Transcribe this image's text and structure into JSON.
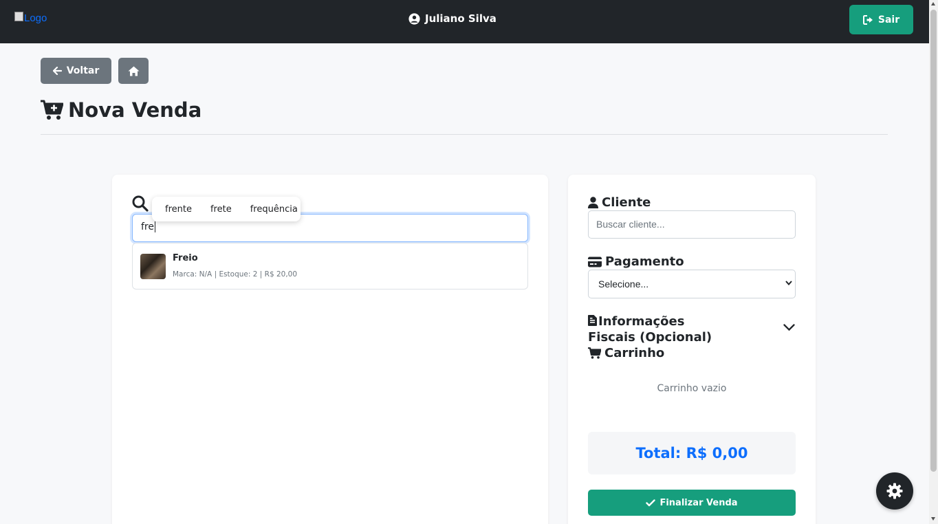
{
  "navbar": {
    "logo_alt": "Logo",
    "user_name": "Juliano Silva",
    "logout_label": "Sair"
  },
  "toolbar": {
    "back_label": "Voltar"
  },
  "page": {
    "title": "Nova Venda"
  },
  "search": {
    "value": "fre",
    "autocomplete": [
      "frente",
      "frete",
      "frequência"
    ],
    "results": [
      {
        "name": "Freio",
        "meta": "Marca: N/A | Estoque: 2 | R$ 20,00"
      }
    ]
  },
  "sidebar": {
    "cliente_label": "Cliente",
    "cliente_placeholder": "Buscar cliente...",
    "pagamento_label": "Pagamento",
    "pagamento_selected": "Selecione...",
    "fiscal_label": "Informações Fiscais (Opcional)",
    "carrinho_label": "Carrinho",
    "carrinho_empty": "Carrinho vazio",
    "total": "Total: R$ 0,00",
    "finalize_label": "Finalizar Venda"
  },
  "colors": {
    "navbar": "#212529",
    "success": "#169e7d",
    "secondary": "#6c757d",
    "primary": "#0d6efd"
  }
}
